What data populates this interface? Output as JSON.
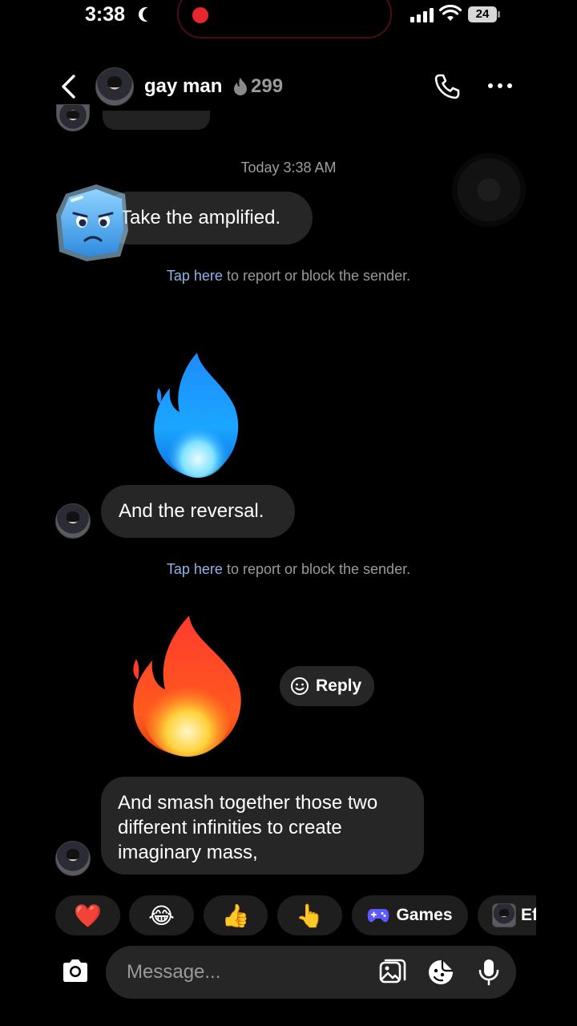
{
  "status_bar": {
    "time": "3:38",
    "battery": "24",
    "icons": [
      "moon-icon",
      "recording-dot",
      "signal-icon",
      "wifi-icon",
      "battery-icon"
    ]
  },
  "header": {
    "contact_name": "gay man",
    "streak_count": "299",
    "icons": [
      "back-arrow-icon",
      "fire-streak-icon",
      "phone-icon",
      "more-icon"
    ]
  },
  "chat": {
    "timestamp": "Today 3:38 AM",
    "messages": [
      {
        "text": "Take the amplified.",
        "avatar": "ice-cube-sticker"
      },
      {
        "text": "And the reversal."
      },
      {
        "text": "And smash together those two different infinities to create imaginary mass,"
      }
    ],
    "report_notice": {
      "link": "Tap here",
      "rest": " to report or block the sender."
    },
    "stickers": [
      "blue-fire-emoji",
      "fire-emoji"
    ],
    "reply_label": "Reply"
  },
  "quick_reactions": {
    "emojis": [
      "❤️",
      "😂",
      "👍",
      "👆"
    ],
    "games_label": "Games",
    "effects_label": "Ef"
  },
  "composer": {
    "placeholder": "Message...",
    "icons": [
      "camera-icon",
      "gallery-icon",
      "sticker-icon",
      "microphone-icon"
    ]
  },
  "colors": {
    "background": "#000000",
    "bubble": "#262626",
    "link": "#8fb4e8",
    "muted": "#9a9a9a",
    "recording": "#e8262f"
  }
}
